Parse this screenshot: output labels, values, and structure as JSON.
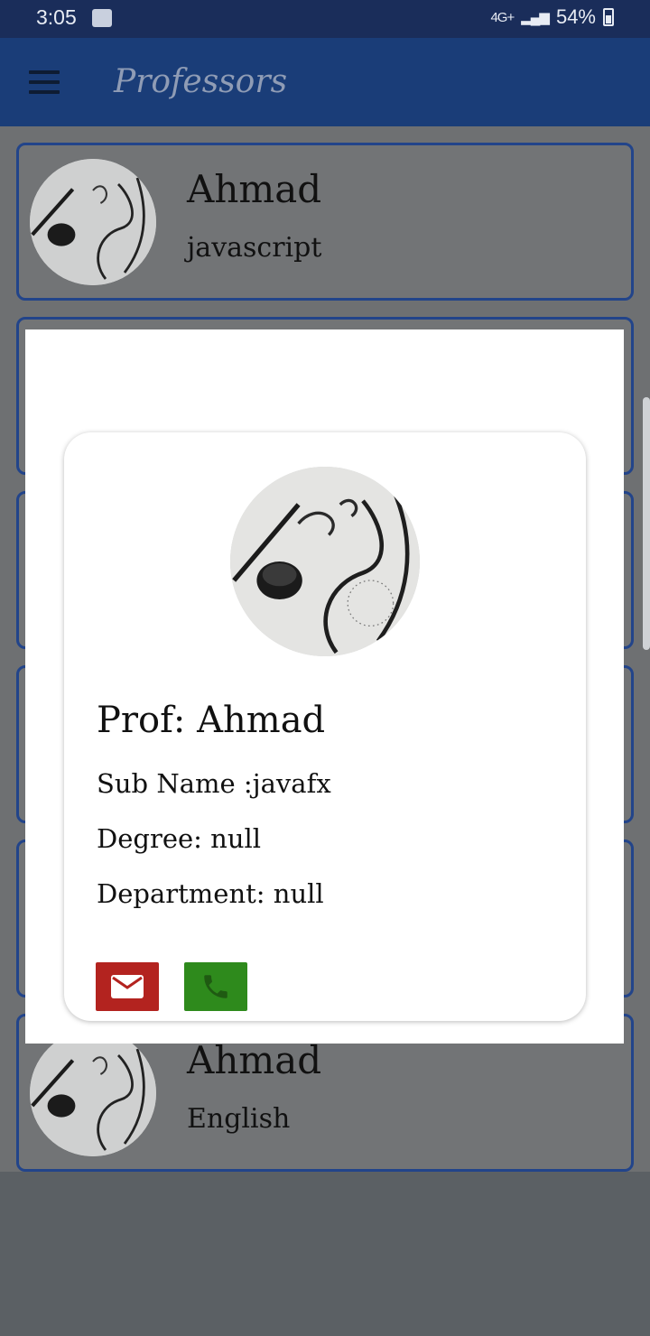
{
  "status_bar": {
    "time": "3:05",
    "network": "4G+",
    "battery": "54%"
  },
  "app_bar": {
    "title": "Professors"
  },
  "list": {
    "items": [
      {
        "name": "Ahmad",
        "subject": "javascript"
      },
      {
        "name": "Ahmad",
        "subject": "English"
      }
    ]
  },
  "dialog": {
    "prof": "Prof: Ahmad",
    "sub_name": "Sub Name :javafx",
    "degree": "Degree: null",
    "department": "Department: null"
  },
  "colors": {
    "status_bar": "#1a2d5a",
    "app_bar": "#1a3d78",
    "card_border": "#22448a",
    "email_button": "#b3231f",
    "phone_button": "#2e8a1c"
  },
  "icons": [
    "menu-icon",
    "wifi-icon",
    "battery-icon",
    "email-icon",
    "phone-icon"
  ]
}
